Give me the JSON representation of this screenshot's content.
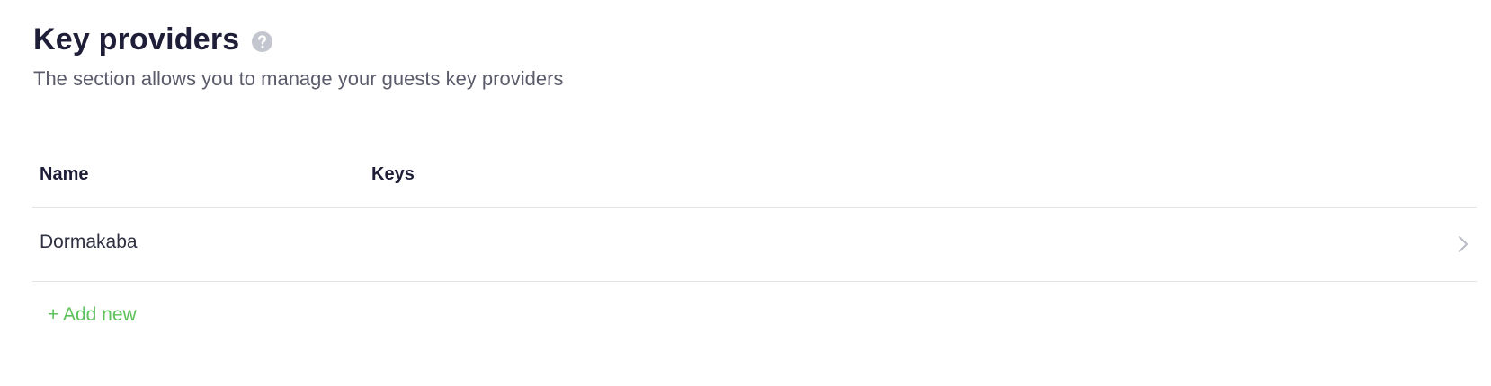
{
  "header": {
    "title": "Key providers",
    "subtitle": "The section allows you to manage your guests key providers",
    "help_icon": "question-circle-icon"
  },
  "table": {
    "columns": [
      "Name",
      "Keys"
    ],
    "rows": [
      {
        "name": "Dormakaba",
        "keys": ""
      }
    ],
    "row_icon": "chevron-right-icon"
  },
  "actions": {
    "add_new_label": "+ Add new"
  },
  "colors": {
    "title": "#1e1e38",
    "subtitle": "#5b5c6b",
    "accent_green": "#5cc15a",
    "divider": "#e3e4e8",
    "icon_gray": "#c3c5cf"
  }
}
